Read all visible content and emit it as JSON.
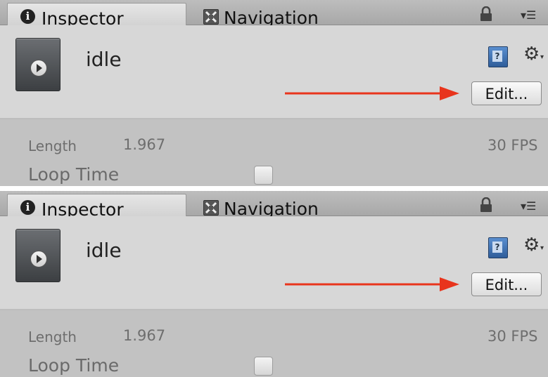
{
  "panels": [
    {
      "tabs": {
        "inspector": "Inspector",
        "navigation": "Navigation"
      },
      "icons": {
        "info": "info-icon",
        "navigation": "navmesh-icon",
        "lock": "lock-icon",
        "menu": "menu-icon",
        "help": "help-book-icon",
        "gear": "gear-icon",
        "clip": "animation-clip-icon"
      },
      "clip": {
        "name": "idle"
      },
      "edit_button": "Edit...",
      "properties": {
        "length_label": "Length",
        "length_value": "1.967",
        "fps": "30 FPS",
        "loop_time_label": "Loop Time",
        "loop_time_checked": false
      }
    },
    {
      "tabs": {
        "inspector": "Inspector",
        "navigation": "Navigation"
      },
      "icons": {
        "info": "info-icon",
        "navigation": "navmesh-icon",
        "lock": "lock-icon",
        "menu": "menu-icon",
        "help": "help-book-icon",
        "gear": "gear-icon",
        "clip": "animation-clip-icon"
      },
      "clip": {
        "name": "idle"
      },
      "edit_button": "Edit...",
      "properties": {
        "length_label": "Length",
        "length_value": "1.967",
        "fps": "30 FPS",
        "loop_time_label": "Loop Time",
        "loop_time_checked": false
      }
    }
  ],
  "colors": {
    "annotation_arrow": "#e8341c",
    "panel_header": "#d7d7d7",
    "panel_body": "#c2c2c2"
  }
}
